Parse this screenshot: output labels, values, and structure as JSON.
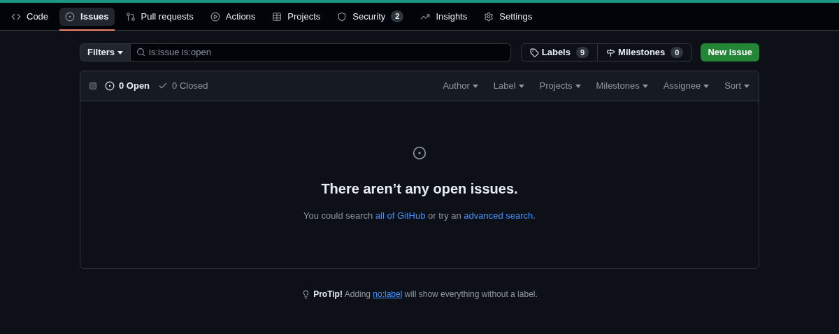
{
  "tabs": [
    {
      "kind": "code",
      "label": "Code",
      "selected": false
    },
    {
      "kind": "issues",
      "label": "Issues",
      "selected": true
    },
    {
      "kind": "pulls",
      "label": "Pull requests",
      "selected": false
    },
    {
      "kind": "actions",
      "label": "Actions",
      "selected": false
    },
    {
      "kind": "projects",
      "label": "Projects",
      "selected": false
    },
    {
      "kind": "security",
      "label": "Security",
      "selected": false,
      "count": "2"
    },
    {
      "kind": "insights",
      "label": "Insights",
      "selected": false
    },
    {
      "kind": "settings",
      "label": "Settings",
      "selected": false
    }
  ],
  "filters": {
    "button": "Filters",
    "search": {
      "placeholder": "is:issue is:open"
    },
    "labels": {
      "label": "Labels",
      "count": "9"
    },
    "milestones": {
      "label": "Milestones",
      "count": "0"
    },
    "new_issue": "New issue"
  },
  "list_header": {
    "checked": false,
    "states": [
      {
        "label": "0 Open",
        "selected": true
      },
      {
        "label": "0 Closed",
        "selected": false
      }
    ],
    "menus": [
      "Author",
      "Label",
      "Projects",
      "Milestones",
      "Assignee",
      "Sort"
    ]
  },
  "empty_state": {
    "title": "There aren’t any open issues.",
    "message": [
      {
        "kind": "text",
        "text": "You could search "
      },
      {
        "kind": "link",
        "text": "all of GitHub"
      },
      {
        "kind": "text",
        "text": " or try an "
      },
      {
        "kind": "link",
        "text": "advanced search"
      },
      {
        "kind": "text",
        "text": "."
      }
    ]
  },
  "protip": {
    "lead": "ProTip!",
    "message": [
      {
        "kind": "text",
        "text": " Adding "
      },
      {
        "kind": "link",
        "text": "no:label"
      },
      {
        "kind": "text",
        "text": " will show everything without a label."
      }
    ]
  }
}
